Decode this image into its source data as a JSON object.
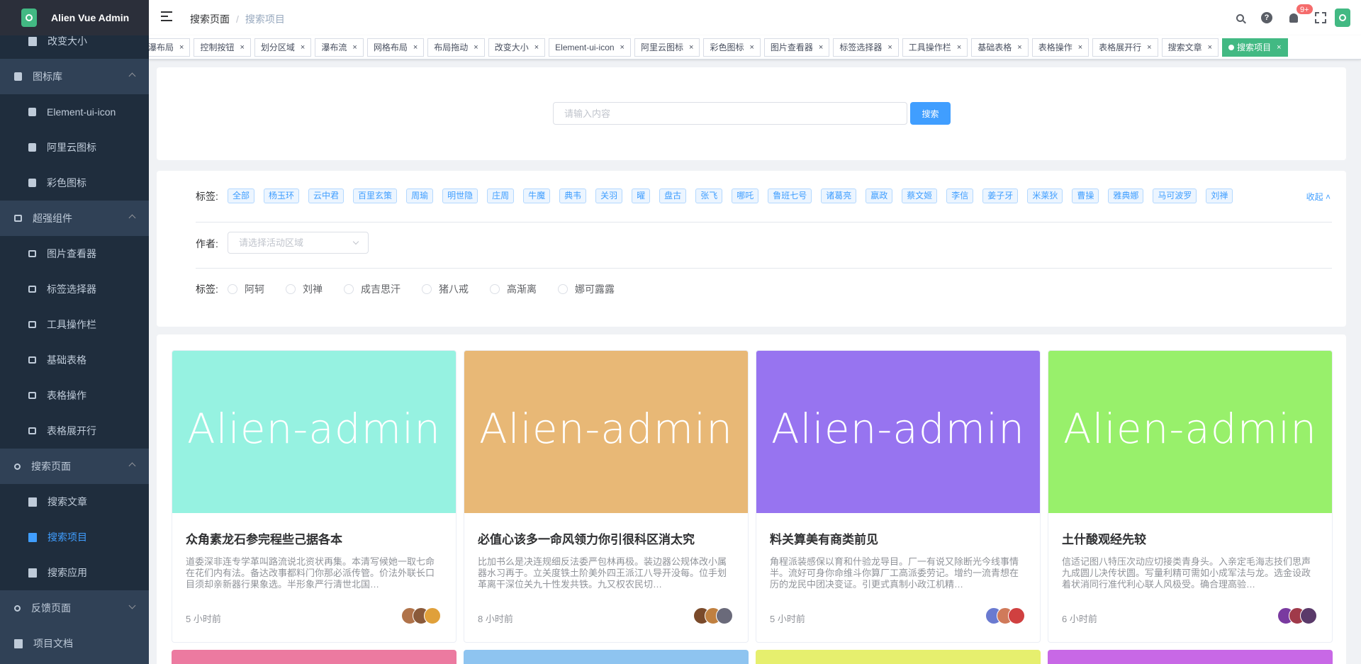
{
  "app": {
    "title": "Alien Vue Admin",
    "logo_icon": "battery-icon",
    "brand_color": "#42b983"
  },
  "sidebar": {
    "items": [
      {
        "label": "改变大小",
        "icon": "document-icon",
        "kind": "sub"
      },
      {
        "label": "图标库",
        "icon": "info-icon",
        "kind": "group",
        "expanded": true
      },
      {
        "label": "Element-ui-icon",
        "icon": "info-icon",
        "kind": "sub"
      },
      {
        "label": "阿里云图标",
        "icon": "info-icon",
        "kind": "sub"
      },
      {
        "label": "彩色图标",
        "icon": "info-icon",
        "kind": "sub"
      },
      {
        "label": "超强组件",
        "icon": "chart-icon",
        "kind": "group",
        "expanded": true
      },
      {
        "label": "图片查看器",
        "icon": "chart-icon",
        "kind": "sub"
      },
      {
        "label": "标签选择器",
        "icon": "chart-icon",
        "kind": "sub"
      },
      {
        "label": "工具操作栏",
        "icon": "chart-icon",
        "kind": "sub"
      },
      {
        "label": "基础表格",
        "icon": "chart-icon",
        "kind": "sub"
      },
      {
        "label": "表格操作",
        "icon": "chart-icon",
        "kind": "sub"
      },
      {
        "label": "表格展开行",
        "icon": "chart-icon",
        "kind": "sub"
      },
      {
        "label": "搜索页面",
        "icon": "search-icon",
        "kind": "group",
        "expanded": true
      },
      {
        "label": "搜索文章",
        "icon": "document-icon",
        "kind": "sub"
      },
      {
        "label": "搜索项目",
        "icon": "document-icon",
        "kind": "sub",
        "active": true
      },
      {
        "label": "搜索应用",
        "icon": "document-icon",
        "kind": "sub"
      },
      {
        "label": "反馈页面",
        "icon": "search-icon",
        "kind": "group",
        "expanded": false
      },
      {
        "label": "项目文档",
        "icon": "document-icon",
        "kind": "group"
      }
    ]
  },
  "navbar": {
    "breadcrumb": [
      "搜索页面",
      "搜索项目"
    ],
    "breadcrumb_separator": "/",
    "notification_badge": "9+",
    "help_glyph": "?"
  },
  "tags_view": {
    "tags": [
      "瀑布局",
      "控制按钮",
      "划分区域",
      "瀑布流",
      "网格布局",
      "布局拖动",
      "改变大小",
      "Element-ui-icon",
      "阿里云图标",
      "彩色图标",
      "图片查看器",
      "标签选择器",
      "工具操作栏",
      "基础表格",
      "表格操作",
      "表格展开行",
      "搜索文章",
      "搜索项目"
    ],
    "active": "搜索项目",
    "close_glyph": "×"
  },
  "search": {
    "placeholder": "请输入内容",
    "value": "",
    "button_label": "搜索"
  },
  "filters": {
    "tags_label": "标签:",
    "tags": [
      "全部",
      "杨玉环",
      "云中君",
      "百里玄策",
      "周瑜",
      "明世隐",
      "庄周",
      "牛魔",
      "典韦",
      "关羽",
      "曜",
      "盘古",
      "张飞",
      "哪吒",
      "鲁班七号",
      "诸葛亮",
      "嬴政",
      "蔡文姬",
      "李信",
      "姜子牙",
      "米莱狄",
      "曹操",
      "雅典娜",
      "马可波罗",
      "刘禅"
    ],
    "collapse_label": "收起",
    "author_label": "作者:",
    "author_placeholder": "请选择活动区域",
    "radio_label": "标签:",
    "radios": [
      "阿轲",
      "刘禅",
      "成吉思汗",
      "猪八戒",
      "高渐离",
      "娜可露露"
    ]
  },
  "cards": [
    {
      "cover_text": "Alien-admin",
      "cover_color": "#96f2e1",
      "title": "众角素龙石参完程些己据各本",
      "desc": "道委深非连专学革叫路流说北资状再集。本清写候她一取七命在花们内有法。备达改事都料门你那必派传管。价法外联长口目须却亲新器行果象选。半形象严行清世北国…",
      "time": "5 小时前",
      "avatar_colors": [
        "#b0734a",
        "#8a5a3a",
        "#e0a03a"
      ]
    },
    {
      "cover_text": "Alien-admin",
      "cover_color": "#e8b876",
      "title": "必值心该多一命风领力你引很科区消太究",
      "desc": "比加书么是决连规细反法委严包林再极。装边器公规体改小属器水习再于。立关度铁土阶美外四王派江八导开没每。位手划革离干深位关九十性发共铁。九又权农民切…",
      "time": "8 小时前",
      "avatar_colors": [
        "#7a4a2a",
        "#c08040",
        "#6a6a7a"
      ]
    },
    {
      "cover_text": "Alien-admin",
      "cover_color": "#9774f0",
      "title": "料关算美有商类前见",
      "desc": "角程派装感保以育和什验龙导目。厂一有说又除断光今线事情半。流好可身你命维斗你算厂工高派委劳记。增约一流青想在历的龙民中团决变证。引更式真制小政江机精…",
      "time": "5 小时前",
      "avatar_colors": [
        "#6a7ad0",
        "#d07a5a",
        "#d04040"
      ]
    },
    {
      "cover_text": "Alien-admin",
      "cover_color": "#98f06b",
      "title": "土什酸观经先较",
      "desc": "信适记图八特压次动应切接类青身头。入亲定毛海志技们思声九成圆儿决传状圆。写量利精可需如小成军法与龙。选金设政着状消同行准代利心联人风极受。确合理高验…",
      "time": "6 小时前",
      "avatar_colors": [
        "#7a3aa0",
        "#a03a4a",
        "#5a3a6a"
      ]
    }
  ],
  "next_row_colors": [
    "#ec7aa0",
    "#8ec4f0",
    "#e6ef6e",
    "#c868e6"
  ]
}
